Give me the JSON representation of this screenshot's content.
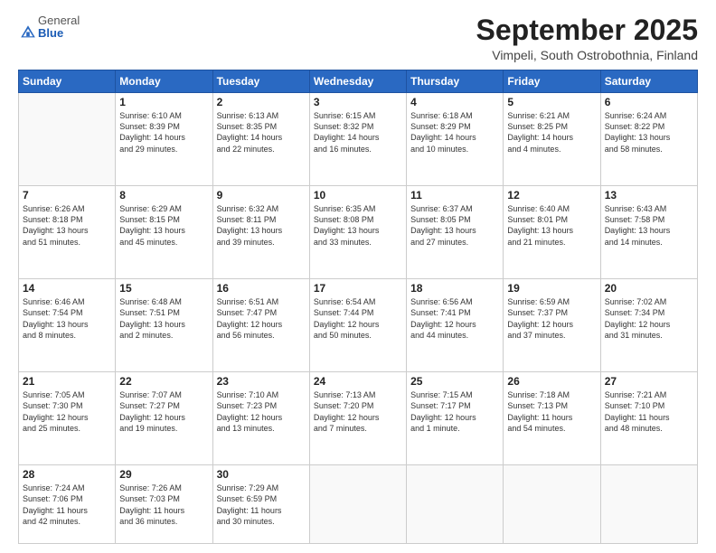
{
  "logo": {
    "general": "General",
    "blue": "Blue"
  },
  "header": {
    "month": "September 2025",
    "location": "Vimpeli, South Ostrobothnia, Finland"
  },
  "weekdays": [
    "Sunday",
    "Monday",
    "Tuesday",
    "Wednesday",
    "Thursday",
    "Friday",
    "Saturday"
  ],
  "weeks": [
    [
      {
        "day": "",
        "info": ""
      },
      {
        "day": "1",
        "info": "Sunrise: 6:10 AM\nSunset: 8:39 PM\nDaylight: 14 hours\nand 29 minutes."
      },
      {
        "day": "2",
        "info": "Sunrise: 6:13 AM\nSunset: 8:35 PM\nDaylight: 14 hours\nand 22 minutes."
      },
      {
        "day": "3",
        "info": "Sunrise: 6:15 AM\nSunset: 8:32 PM\nDaylight: 14 hours\nand 16 minutes."
      },
      {
        "day": "4",
        "info": "Sunrise: 6:18 AM\nSunset: 8:29 PM\nDaylight: 14 hours\nand 10 minutes."
      },
      {
        "day": "5",
        "info": "Sunrise: 6:21 AM\nSunset: 8:25 PM\nDaylight: 14 hours\nand 4 minutes."
      },
      {
        "day": "6",
        "info": "Sunrise: 6:24 AM\nSunset: 8:22 PM\nDaylight: 13 hours\nand 58 minutes."
      }
    ],
    [
      {
        "day": "7",
        "info": "Sunrise: 6:26 AM\nSunset: 8:18 PM\nDaylight: 13 hours\nand 51 minutes."
      },
      {
        "day": "8",
        "info": "Sunrise: 6:29 AM\nSunset: 8:15 PM\nDaylight: 13 hours\nand 45 minutes."
      },
      {
        "day": "9",
        "info": "Sunrise: 6:32 AM\nSunset: 8:11 PM\nDaylight: 13 hours\nand 39 minutes."
      },
      {
        "day": "10",
        "info": "Sunrise: 6:35 AM\nSunset: 8:08 PM\nDaylight: 13 hours\nand 33 minutes."
      },
      {
        "day": "11",
        "info": "Sunrise: 6:37 AM\nSunset: 8:05 PM\nDaylight: 13 hours\nand 27 minutes."
      },
      {
        "day": "12",
        "info": "Sunrise: 6:40 AM\nSunset: 8:01 PM\nDaylight: 13 hours\nand 21 minutes."
      },
      {
        "day": "13",
        "info": "Sunrise: 6:43 AM\nSunset: 7:58 PM\nDaylight: 13 hours\nand 14 minutes."
      }
    ],
    [
      {
        "day": "14",
        "info": "Sunrise: 6:46 AM\nSunset: 7:54 PM\nDaylight: 13 hours\nand 8 minutes."
      },
      {
        "day": "15",
        "info": "Sunrise: 6:48 AM\nSunset: 7:51 PM\nDaylight: 13 hours\nand 2 minutes."
      },
      {
        "day": "16",
        "info": "Sunrise: 6:51 AM\nSunset: 7:47 PM\nDaylight: 12 hours\nand 56 minutes."
      },
      {
        "day": "17",
        "info": "Sunrise: 6:54 AM\nSunset: 7:44 PM\nDaylight: 12 hours\nand 50 minutes."
      },
      {
        "day": "18",
        "info": "Sunrise: 6:56 AM\nSunset: 7:41 PM\nDaylight: 12 hours\nand 44 minutes."
      },
      {
        "day": "19",
        "info": "Sunrise: 6:59 AM\nSunset: 7:37 PM\nDaylight: 12 hours\nand 37 minutes."
      },
      {
        "day": "20",
        "info": "Sunrise: 7:02 AM\nSunset: 7:34 PM\nDaylight: 12 hours\nand 31 minutes."
      }
    ],
    [
      {
        "day": "21",
        "info": "Sunrise: 7:05 AM\nSunset: 7:30 PM\nDaylight: 12 hours\nand 25 minutes."
      },
      {
        "day": "22",
        "info": "Sunrise: 7:07 AM\nSunset: 7:27 PM\nDaylight: 12 hours\nand 19 minutes."
      },
      {
        "day": "23",
        "info": "Sunrise: 7:10 AM\nSunset: 7:23 PM\nDaylight: 12 hours\nand 13 minutes."
      },
      {
        "day": "24",
        "info": "Sunrise: 7:13 AM\nSunset: 7:20 PM\nDaylight: 12 hours\nand 7 minutes."
      },
      {
        "day": "25",
        "info": "Sunrise: 7:15 AM\nSunset: 7:17 PM\nDaylight: 12 hours\nand 1 minute."
      },
      {
        "day": "26",
        "info": "Sunrise: 7:18 AM\nSunset: 7:13 PM\nDaylight: 11 hours\nand 54 minutes."
      },
      {
        "day": "27",
        "info": "Sunrise: 7:21 AM\nSunset: 7:10 PM\nDaylight: 11 hours\nand 48 minutes."
      }
    ],
    [
      {
        "day": "28",
        "info": "Sunrise: 7:24 AM\nSunset: 7:06 PM\nDaylight: 11 hours\nand 42 minutes."
      },
      {
        "day": "29",
        "info": "Sunrise: 7:26 AM\nSunset: 7:03 PM\nDaylight: 11 hours\nand 36 minutes."
      },
      {
        "day": "30",
        "info": "Sunrise: 7:29 AM\nSunset: 6:59 PM\nDaylight: 11 hours\nand 30 minutes."
      },
      {
        "day": "",
        "info": ""
      },
      {
        "day": "",
        "info": ""
      },
      {
        "day": "",
        "info": ""
      },
      {
        "day": "",
        "info": ""
      }
    ]
  ]
}
